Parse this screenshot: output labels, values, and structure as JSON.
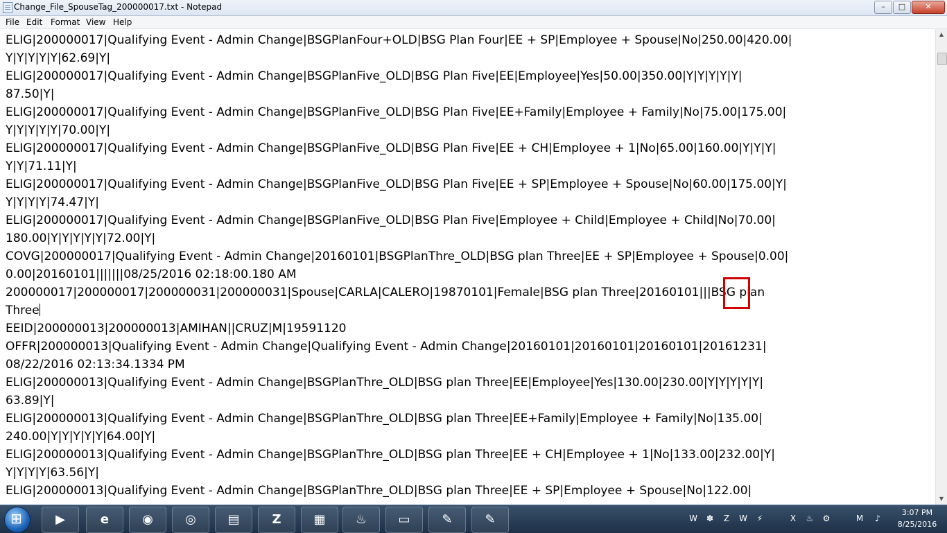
{
  "window": {
    "title": "Change_File_SpouseTag_200000017.txt - Notepad",
    "min_glyph": "–",
    "max_glyph": "□",
    "close_glyph": "✕"
  },
  "menu": [
    "File",
    "Edit",
    "Format",
    "View",
    "Help"
  ],
  "lines": [
    "ELIG|200000017|Qualifying Event - Admin Change|BSGPlanFour+OLD|BSG Plan Four|EE + SP|Employee + Spouse|No|250.00|420.00|",
    "Y|Y|Y|Y|Y|62.69|Y|",
    "ELIG|200000017|Qualifying Event - Admin Change|BSGPlanFive_OLD|BSG Plan Five|EE|Employee|Yes|50.00|350.00|Y|Y|Y|Y|Y|",
    "87.50|Y|",
    "ELIG|200000017|Qualifying Event - Admin Change|BSGPlanFive_OLD|BSG Plan Five|EE+Family|Employee + Family|No|75.00|175.00|",
    "Y|Y|Y|Y|Y|70.00|Y|",
    "ELIG|200000017|Qualifying Event - Admin Change|BSGPlanFive_OLD|BSG Plan Five|EE + CH|Employee + 1|No|65.00|160.00|Y|Y|Y|",
    "Y|Y|71.11|Y|",
    "ELIG|200000017|Qualifying Event - Admin Change|BSGPlanFive_OLD|BSG Plan Five|EE + SP|Employee + Spouse|No|60.00|175.00|Y|",
    "Y|Y|Y|Y|74.47|Y|",
    "ELIG|200000017|Qualifying Event - Admin Change|BSGPlanFive_OLD|BSG Plan Five|Employee + Child|Employee + Child|No|70.00|",
    "180.00|Y|Y|Y|Y|Y|72.00|Y|",
    "COVG|200000017|Qualifying Event - Admin Change|20160101|BSGPlanThre_OLD|BSG plan Three|EE + SP|Employee + Spouse|0.00|",
    "0.00|20160101|||||||08/25/2016 02:18:00.180 AM",
    "200000017|200000017|200000031|200000031|Spouse|CARLA|CALERO|19870101|Female|BSG plan Three|20160101|||BSG plan",
    "Three",
    "EEID|200000013|200000013|AMIHAN||CRUZ|M|19591120",
    "OFFR|200000013|Qualifying Event - Admin Change|Qualifying Event - Admin Change|20160101|20160101|20160101|20161231|",
    "08/22/2016 02:13:34.1334 PM",
    "ELIG|200000013|Qualifying Event - Admin Change|BSGPlanThre_OLD|BSG plan Three|EE|Employee|Yes|130.00|230.00|Y|Y|Y|Y|Y|",
    "63.89|Y|",
    "ELIG|200000013|Qualifying Event - Admin Change|BSGPlanThre_OLD|BSG plan Three|EE+Family|Employee + Family|No|135.00|",
    "240.00|Y|Y|Y|Y|Y|64.00|Y|",
    "ELIG|200000013|Qualifying Event - Admin Change|BSGPlanThre_OLD|BSG plan Three|EE + CH|Employee + 1|No|133.00|232.00|Y|",
    "Y|Y|Y|Y|63.56|Y|",
    "ELIG|200000013|Qualifying Event - Admin Change|BSGPlanThre_OLD|BSG plan Three|EE + SP|Employee + Spouse|No|122.00|"
  ],
  "scrollbar": {
    "up_glyph": "▲",
    "down_glyph": "▼"
  },
  "taskbar": {
    "start_label": "Start",
    "apps": [
      {
        "name": "media-player",
        "glyph": "▶"
      },
      {
        "name": "internet-explorer",
        "glyph": "e"
      },
      {
        "name": "firefox",
        "glyph": "◉"
      },
      {
        "name": "chrome",
        "glyph": "◎"
      },
      {
        "name": "sticky-notes",
        "glyph": "▤"
      },
      {
        "name": "z-app",
        "glyph": "Z"
      },
      {
        "name": "calculator",
        "glyph": "▦"
      },
      {
        "name": "flame-app",
        "glyph": "♨"
      },
      {
        "name": "file-explorer",
        "glyph": "▭"
      },
      {
        "name": "notepad-1",
        "glyph": "✎"
      },
      {
        "name": "notepad-2",
        "glyph": "✎"
      }
    ],
    "tray": [
      "W",
      "✽",
      "Z",
      "W",
      "⚡",
      "X",
      "♨",
      "⚙",
      "M",
      "♪"
    ],
    "clock_time": "3:07 PM",
    "clock_date": "8/25/2016"
  },
  "colors": {
    "highlight": "#d00000"
  }
}
